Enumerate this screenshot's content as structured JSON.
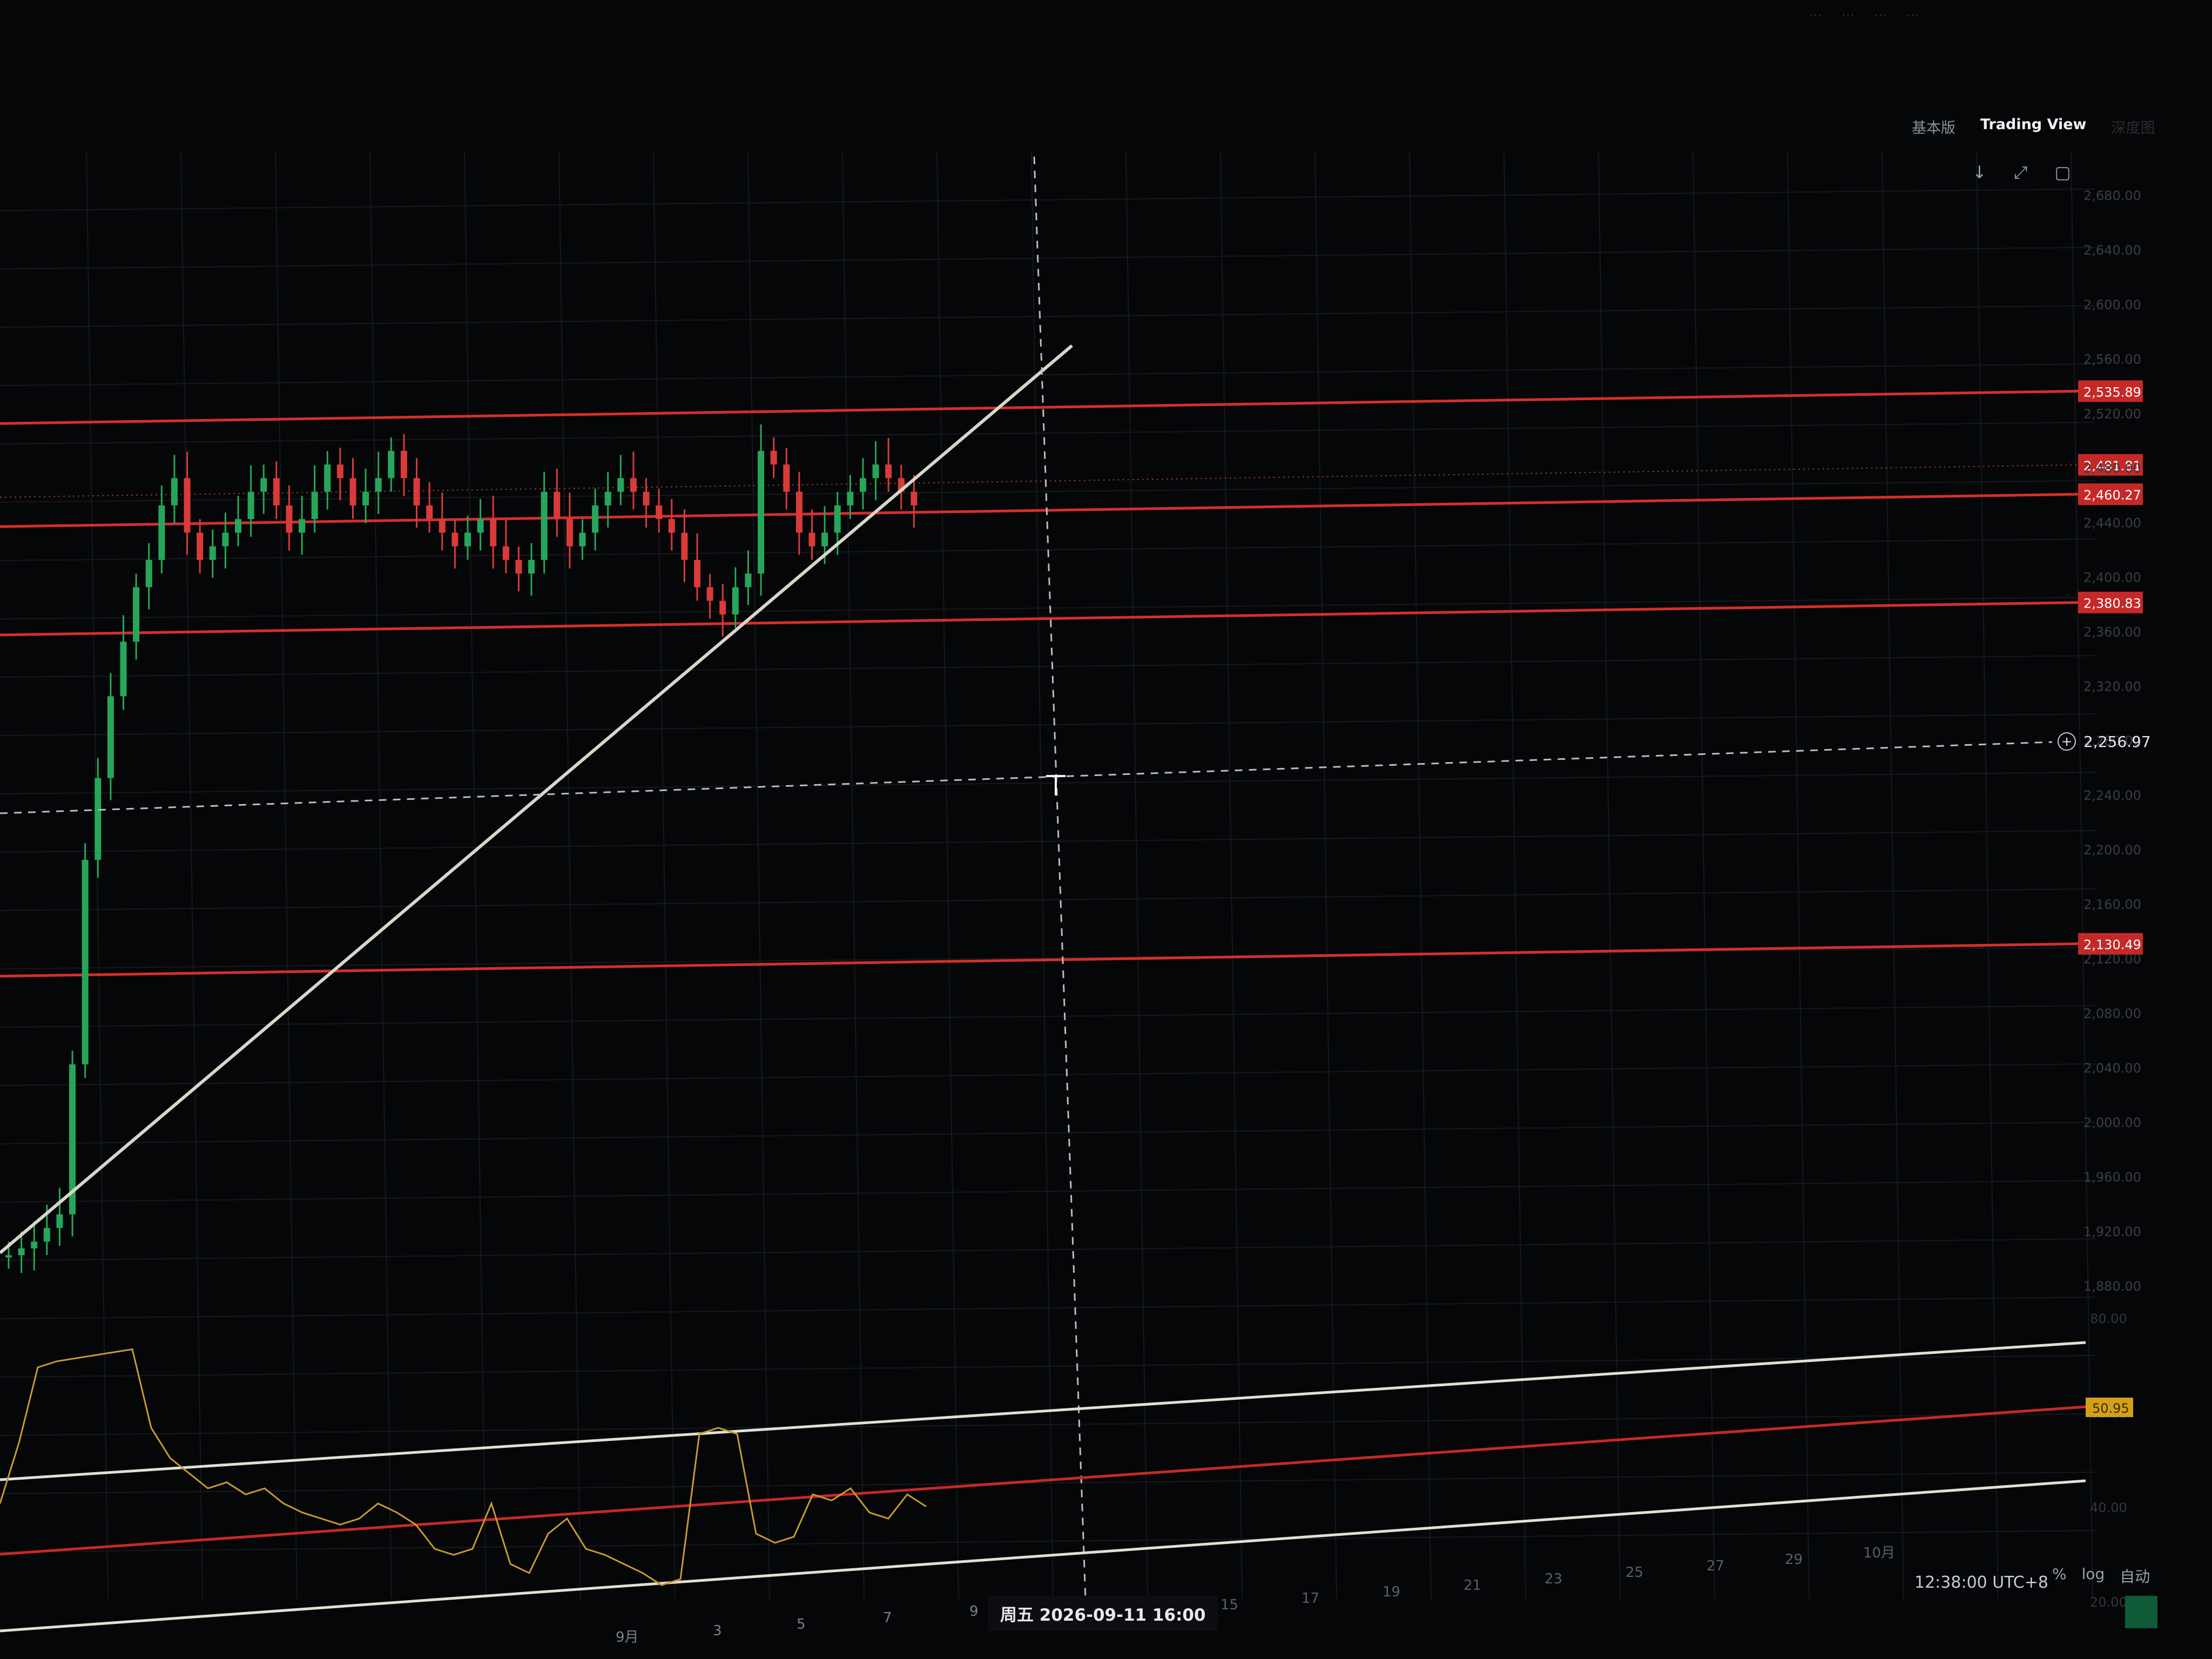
{
  "window": {
    "faint_top_items": [
      "…",
      "…",
      "…",
      "…"
    ]
  },
  "header": {
    "tabs": [
      {
        "label": "基本版",
        "active": false
      },
      {
        "label": "Trading View",
        "active": true
      },
      {
        "label": "深度图",
        "active": false
      }
    ],
    "toolbar_icons": [
      "download-icon",
      "fullscreen-icon",
      "screenshot-icon"
    ]
  },
  "price_axis": {
    "ticks": [
      "2,680.00",
      "2,640.00",
      "2,600.00",
      "2,560.00",
      "2,520.00",
      "2,480.00",
      "2,440.00",
      "2,400.00",
      "2,360.00",
      "2,320.00",
      "2,280.00",
      "2,240.00",
      "2,200.00",
      "2,160.00",
      "2,120.00",
      "2,080.00",
      "2,040.00",
      "2,000.00",
      "1,960.00",
      "1,920.00",
      "1,880.00"
    ],
    "line_labels": [
      "2,535.89",
      "2,481.81",
      "2,460.27",
      "2,380.83",
      "2,130.49"
    ],
    "crosshair_price": "2,256.97",
    "accent_color": "#c62828"
  },
  "indicator_axis": {
    "ticks": [
      "80.00",
      "60.00",
      "40.00",
      "20.00"
    ],
    "current_value": "50.95",
    "current_color": "#d4a017"
  },
  "time_axis": {
    "ticks": [
      "9月",
      "3",
      "5",
      "7",
      "9",
      "15",
      "17",
      "19",
      "21",
      "23",
      "25",
      "27",
      "29",
      "10月"
    ],
    "crosshair_label": "周五 2026-09-11  16:00"
  },
  "status_bar": {
    "clock": "12:38:00 UTC+8",
    "percent_label": "%",
    "log_label": "log",
    "auto_label": "自动"
  },
  "colors": {
    "up_candle": "#26a65b",
    "down_candle": "#d93a3a",
    "trendline": "#d8d6c8",
    "rsi_line": "#c89a2e",
    "rsi_channel": "#e2e0d3",
    "rsi_mid": "#c62828"
  },
  "chart_data": {
    "type": "line",
    "title": "",
    "xlabel": "",
    "ylabel": "",
    "ylim": [
      1880,
      2700
    ],
    "horizontal_levels": [
      2535.89,
      2481.81,
      2460.27,
      2380.83,
      2130.49
    ],
    "crosshair_price": 2256.97,
    "series": [
      {
        "values": [
          1910,
          1915,
          1920,
          1930,
          1940,
          2050,
          2200,
          2260,
          2320,
          2360,
          2400,
          2420,
          2460,
          2480,
          2440,
          2420,
          2430,
          2440,
          2450,
          2470,
          2480,
          2460,
          2440,
          2450,
          2470,
          2490,
          2480,
          2460,
          2470,
          2480,
          2500,
          2480,
          2460,
          2450,
          2440,
          2430,
          2440,
          2450,
          2430,
          2420,
          2410,
          2420,
          2470,
          2450,
          2430,
          2440,
          2460,
          2470,
          2480,
          2470,
          2460,
          2450,
          2440,
          2420,
          2400,
          2390,
          2380,
          2400,
          2410,
          2500,
          2490,
          2470,
          2440,
          2430,
          2440,
          2460,
          2470,
          2480,
          2490,
          2480,
          2470,
          2460
        ]
      },
      {
        "values": [
          35,
          55,
          80,
          82,
          83,
          84,
          85,
          86,
          60,
          50,
          45,
          40,
          42,
          38,
          40,
          35,
          32,
          30,
          28,
          30,
          35,
          32,
          28,
          20,
          18,
          20,
          35,
          15,
          12,
          25,
          30,
          20,
          18,
          15,
          12,
          8,
          10,
          58,
          60,
          58,
          25,
          22,
          24,
          38,
          36,
          40,
          32,
          30,
          38,
          34
        ]
      }
    ]
  }
}
